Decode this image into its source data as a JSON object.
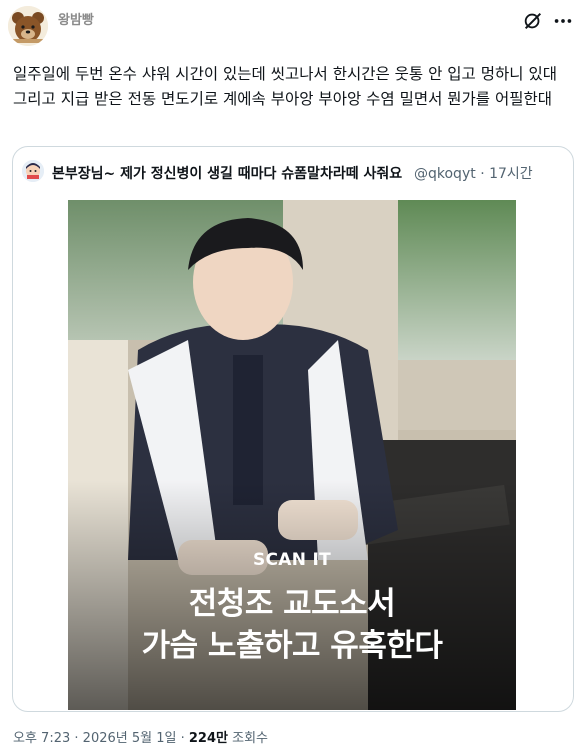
{
  "author": {
    "name": "왕밤빵"
  },
  "tweet": {
    "text": "일주일에 두번 온수 샤워 시간이 있는데 씻고나서 한시간은 웃통 안 입고 멍하니 있대 그리고 지급 받은 전동 면도기로 계에속 부아앙 부아앙 수염 밀면서 뭔가를 어필한대"
  },
  "quote": {
    "name": "본부장님~ 제가 정신병이 생길 때마다 슈폼말차라떼 사줘요",
    "handle": "@qkoqyt",
    "separator": "·",
    "time": "17시간",
    "media": {
      "overlay_small": "SCAN IT",
      "caption_line1": "전청조 교도소서",
      "caption_line2": "가슴 노출하고 유혹한다"
    }
  },
  "footer": {
    "time": "오후 7:23",
    "sep1": "·",
    "date": "2026년 5월 1일",
    "sep2": "·",
    "views_count": "224만",
    "views_label": "조회수"
  },
  "icons": {
    "grok": "grok-icon",
    "more": "more-icon"
  },
  "colors": {
    "text": "#0f1419",
    "secondary": "#536471",
    "border": "#cfd9de",
    "author_muted": "#8b8b8b"
  }
}
